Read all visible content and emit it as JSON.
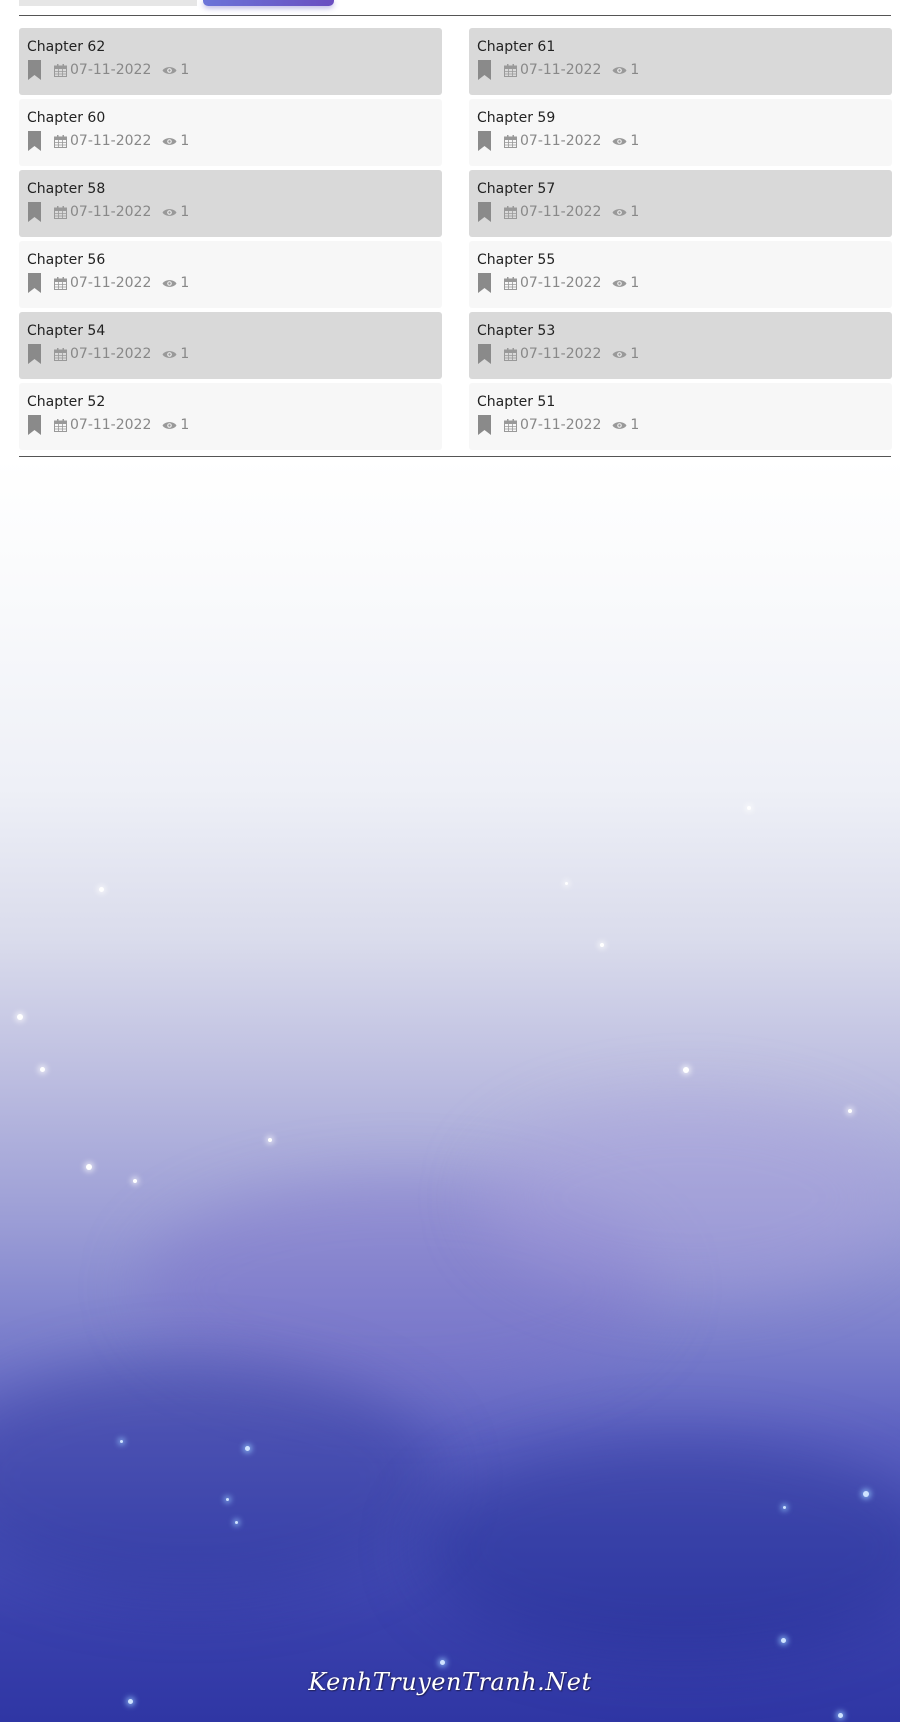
{
  "chapters": [
    {
      "title": "Chapter 62",
      "date": "07-11-2022",
      "views": "1"
    },
    {
      "title": "Chapter 61",
      "date": "07-11-2022",
      "views": "1"
    },
    {
      "title": "Chapter 60",
      "date": "07-11-2022",
      "views": "1"
    },
    {
      "title": "Chapter 59",
      "date": "07-11-2022",
      "views": "1"
    },
    {
      "title": "Chapter 58",
      "date": "07-11-2022",
      "views": "1"
    },
    {
      "title": "Chapter 57",
      "date": "07-11-2022",
      "views": "1"
    },
    {
      "title": "Chapter 56",
      "date": "07-11-2022",
      "views": "1"
    },
    {
      "title": "Chapter 55",
      "date": "07-11-2022",
      "views": "1"
    },
    {
      "title": "Chapter 54",
      "date": "07-11-2022",
      "views": "1"
    },
    {
      "title": "Chapter 53",
      "date": "07-11-2022",
      "views": "1"
    },
    {
      "title": "Chapter 52",
      "date": "07-11-2022",
      "views": "1"
    },
    {
      "title": "Chapter 51",
      "date": "07-11-2022",
      "views": "1"
    }
  ],
  "watermark": "KenhTruyenTranh.Net",
  "icons": {
    "bookmark": "bookmark-icon",
    "calendar": "calendar-icon",
    "views": "eye-icon"
  },
  "colors": {
    "active_tab": "#6a5fd0",
    "card_dark": "#d9d9d9",
    "card_light": "#f7f7f7",
    "meta_text": "#888888",
    "sky_bottom": "#2f36a4"
  }
}
